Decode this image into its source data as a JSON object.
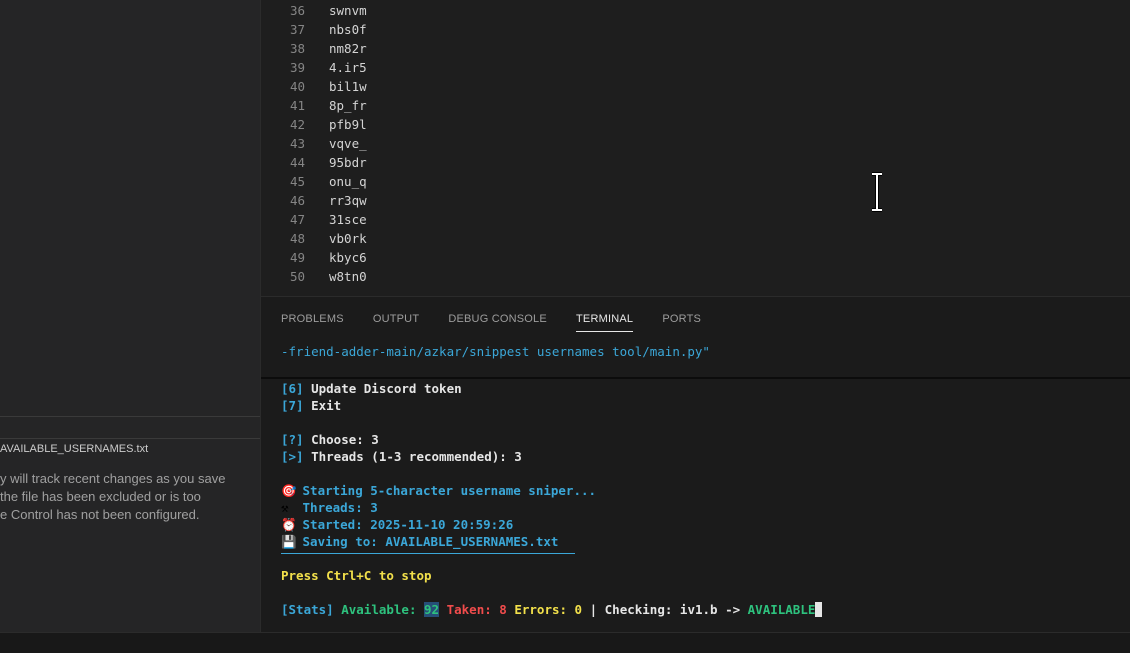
{
  "timeline": {
    "title": "AVAILABLE_USERNAMES.txt",
    "message_lines": [
      "y will track recent changes as you save",
      "the file has been excluded or is too",
      "e Control has not been configured."
    ]
  },
  "editor": {
    "lines": [
      {
        "num": "36",
        "text": "swnvm"
      },
      {
        "num": "37",
        "text": "nbs0f"
      },
      {
        "num": "38",
        "text": "nm82r"
      },
      {
        "num": "39",
        "text": "4.ir5"
      },
      {
        "num": "40",
        "text": "bil1w"
      },
      {
        "num": "41",
        "text": "8p_fr"
      },
      {
        "num": "42",
        "text": "pfb9l"
      },
      {
        "num": "43",
        "text": "vqve_"
      },
      {
        "num": "44",
        "text": "95bdr"
      },
      {
        "num": "45",
        "text": "onu_q"
      },
      {
        "num": "46",
        "text": "rr3qw"
      },
      {
        "num": "47",
        "text": "31sce"
      },
      {
        "num": "48",
        "text": "vb0rk"
      },
      {
        "num": "49",
        "text": "kbyc6"
      },
      {
        "num": "50",
        "text": "w8tn0"
      }
    ]
  },
  "panel": {
    "tabs": [
      {
        "label": "PROBLEMS",
        "active": false
      },
      {
        "label": "OUTPUT",
        "active": false
      },
      {
        "label": "DEBUG CONSOLE",
        "active": false
      },
      {
        "label": "TERMINAL",
        "active": true
      },
      {
        "label": "PORTS",
        "active": false
      }
    ],
    "path": "-friend-adder-main/azkar/snippest usernames tool/main.py\""
  },
  "terminal": {
    "opt6_key": "[6]",
    "opt6_text": " Update Discord token",
    "opt7_key": "[7]",
    "opt7_text": " Exit",
    "choose_key": "[?]",
    "choose_text": " Choose: 3",
    "threads_key": "[>]",
    "threads_text": " Threads (1-3 recommended): 3",
    "starting": "Starting 5-character username sniper...",
    "threads_info": "Threads: 3",
    "started": "Started: 2025-11-10 20:59:26",
    "saving": "Saving to: AVAILABLE_USERNAMES.txt",
    "stop": "Press Ctrl+C to stop",
    "stats": {
      "prefix": "[Stats]",
      "available_label": " Available: ",
      "available_value": "92",
      "taken_label": " Taken: ",
      "taken_value": "8",
      "errors_label": " Errors: ",
      "errors_value": "0",
      "sep": " | ",
      "checking_label": "Checking: ",
      "checking_value": "iv1.b -> ",
      "status": "AVAILABLE"
    }
  },
  "icons": {
    "target": "target-icon",
    "tools": "hammer-wrench-icon",
    "clock": "alarm-clock-icon",
    "save": "floppy-disk-icon"
  },
  "colors": {
    "terminal_cyan": "#3ba7d8",
    "terminal_yellow": "#f2e04b",
    "terminal_green": "#2ec27e",
    "terminal_red": "#f14c4c"
  }
}
